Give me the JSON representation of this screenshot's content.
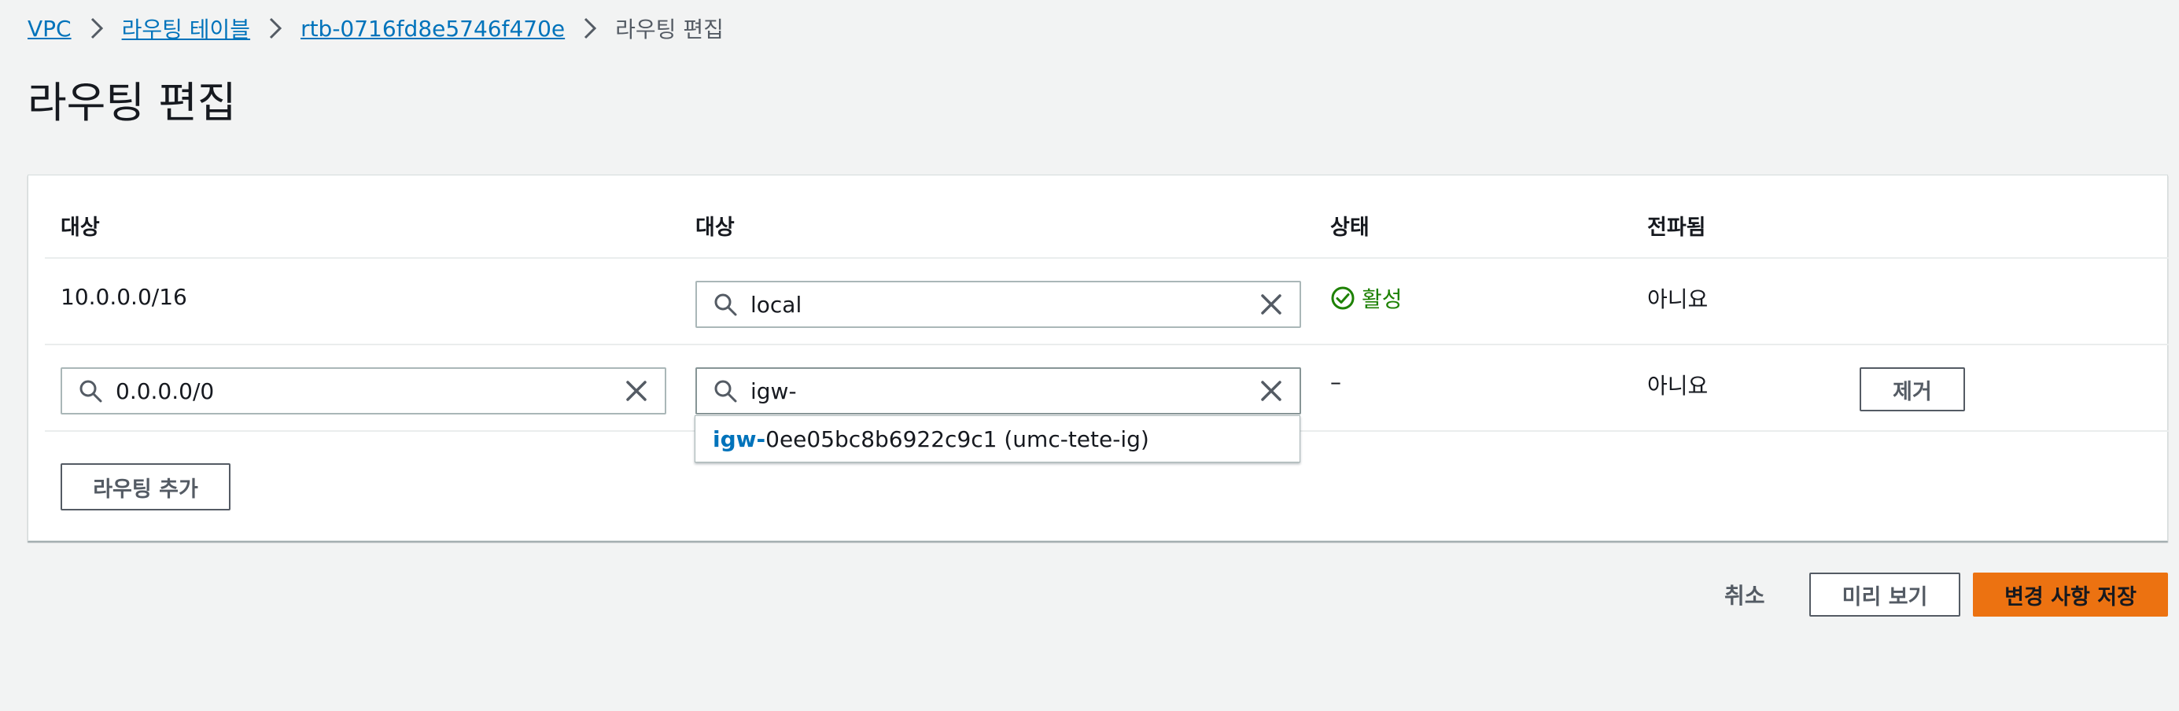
{
  "breadcrumb": {
    "items": [
      "VPC",
      "라우팅 테이블",
      "rtb-0716fd8e5746f470e"
    ],
    "current": "라우팅 편집"
  },
  "page": {
    "title": "라우팅 편집"
  },
  "table": {
    "headers": [
      "대상",
      "대상",
      "상태",
      "전파됨"
    ],
    "rows": [
      {
        "destination": "10.0.0.0/16",
        "target": "local",
        "status": "활성",
        "propagated": "아니요"
      },
      {
        "destination": "0.0.0.0/0",
        "target": "igw-",
        "status": "–",
        "propagated": "아니요",
        "remove_label": "제거"
      }
    ],
    "add_route_label": "라우팅 추가"
  },
  "dropdown": {
    "options": [
      {
        "match": "igw-",
        "rest": "0ee05bc8b6922c9c1 (umc-tete-ig)"
      }
    ]
  },
  "footer": {
    "cancel_label": "취소",
    "preview_label": "미리 보기",
    "save_label": "변경 사항 저장"
  },
  "colors": {
    "link": "#0073bb",
    "primary_button": "#ec7211",
    "status_active": "#1d8102",
    "background": "#f2f3f3"
  },
  "icons": [
    "chevron-right-icon",
    "search-icon",
    "clear-icon",
    "status-success-icon"
  ]
}
